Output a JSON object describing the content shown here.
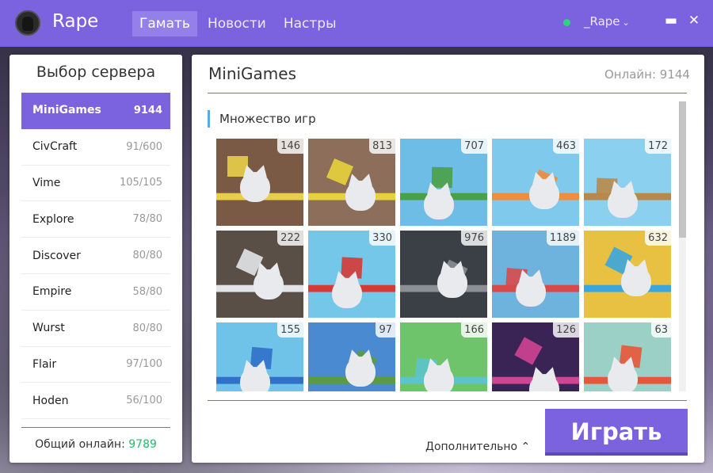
{
  "app": {
    "brand": "Rape"
  },
  "nav": [
    {
      "label": "Гамать",
      "active": true
    },
    {
      "label": "Новости",
      "active": false
    },
    {
      "label": "Настры",
      "active": false
    }
  ],
  "user": {
    "name": "_Rape",
    "status_color": "#2bd67b"
  },
  "window": {
    "minimize": "▬",
    "close": "✕"
  },
  "left": {
    "title": "Выбор сервера",
    "servers": [
      {
        "name": "MiniGames",
        "count": "9144",
        "active": true
      },
      {
        "name": "CivCraft",
        "count": "91/600"
      },
      {
        "name": "Vime",
        "count": "105/105"
      },
      {
        "name": "Explore",
        "count": "78/80"
      },
      {
        "name": "Discover",
        "count": "80/80"
      },
      {
        "name": "Empire",
        "count": "58/80"
      },
      {
        "name": "Wurst",
        "count": "80/80"
      },
      {
        "name": "Flair",
        "count": "97/100"
      },
      {
        "name": "Hoden",
        "count": "56/100"
      }
    ],
    "total_label": "Общий онлайн:",
    "total_value": "9789"
  },
  "main": {
    "title": "MiniGames",
    "online": "Онлайн: 9144",
    "section": "Множество игр",
    "games": [
      {
        "count": "146",
        "bg": "#7a5a44",
        "accent": "#e8cf4a"
      },
      {
        "count": "813",
        "bg": "#8c6e5a",
        "accent": "#e6d23b"
      },
      {
        "count": "707",
        "bg": "#6dbde6",
        "accent": "#4aa046"
      },
      {
        "count": "463",
        "bg": "#7ec9ec",
        "accent": "#f08c3a"
      },
      {
        "count": "172",
        "bg": "#8cd0f0",
        "accent": "#b8884a"
      },
      {
        "count": "222",
        "bg": "#5a4f46",
        "accent": "#e2e4e8"
      },
      {
        "count": "330",
        "bg": "#74c7e9",
        "accent": "#d63a36"
      },
      {
        "count": "976",
        "bg": "#3b3f46",
        "accent": "#8c8f94"
      },
      {
        "count": "1189",
        "bg": "#6db3de",
        "accent": "#d84a4a"
      },
      {
        "count": "632",
        "bg": "#e8c042",
        "accent": "#3aa6e0"
      },
      {
        "count": "155",
        "bg": "#6fc2e8",
        "accent": "#3070c8"
      },
      {
        "count": "97",
        "bg": "#4a8ad0",
        "accent": "#5c9c3c"
      },
      {
        "count": "166",
        "bg": "#6ec46a",
        "accent": "#5cc4cc"
      },
      {
        "count": "126",
        "bg": "#3a2456",
        "accent": "#d04494"
      },
      {
        "count": "63",
        "bg": "#9ad0c6",
        "accent": "#e8563a"
      }
    ],
    "more_label": "Дополнительно ⌃",
    "play_label": "Играть"
  },
  "colors": {
    "accent": "#7b63e0",
    "online_green": "#2bb56a"
  }
}
